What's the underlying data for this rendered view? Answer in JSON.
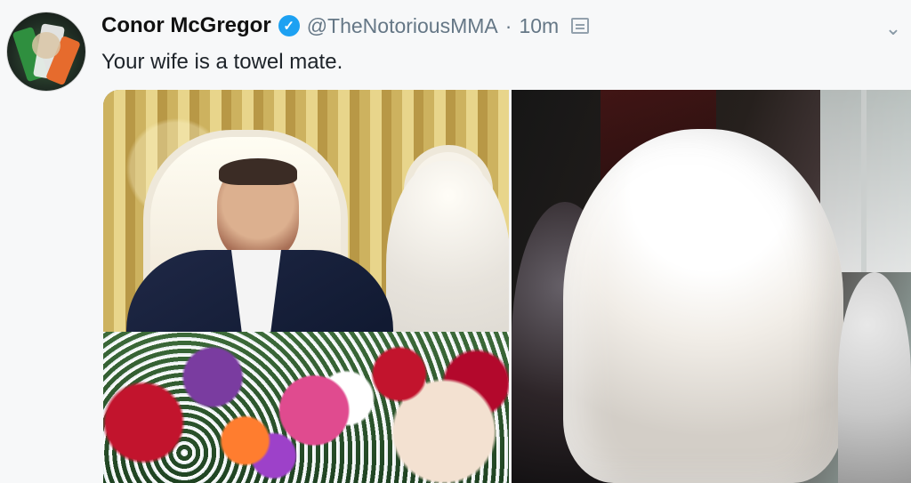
{
  "tweet": {
    "author_name": "Conor McGregor",
    "handle": "@TheNotoriousMMA",
    "separator": "·",
    "time": "10m",
    "text": "Your wife is a towel mate.",
    "verified": true,
    "icons": {
      "verified": "verified-badge-icon",
      "moment": "moment-icon",
      "more": "chevron-down-icon"
    },
    "colors": {
      "verified_blue": "#1da1f2",
      "muted_text": "#657786"
    }
  },
  "media": {
    "images": [
      {
        "subject": "left-photo"
      },
      {
        "subject": "right-photo"
      }
    ]
  }
}
